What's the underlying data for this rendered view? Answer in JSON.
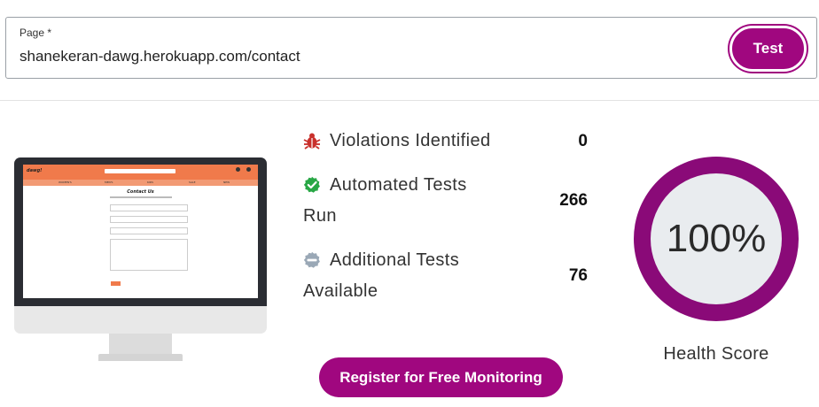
{
  "form": {
    "label": "Page *",
    "url_value": "shanekeran-dawg.herokuapp.com/contact",
    "test_button": "Test"
  },
  "preview": {
    "site_logo": "dawg!",
    "nav_items": [
      "WOMEN'S",
      "MEN'S",
      "KIDS",
      "SALE",
      "NEW"
    ],
    "page_heading": "Contact Us"
  },
  "stats": {
    "violations": {
      "label": "Violations Identified",
      "value": "0",
      "icon": "bug-icon"
    },
    "automated": {
      "label_line1": "Automated Tests",
      "label_line2": "Run",
      "value": "266",
      "icon": "check-circle-icon"
    },
    "additional": {
      "label_line1": "Additional Tests",
      "label_line2": "Available",
      "value": "76",
      "icon": "minus-circle-icon"
    }
  },
  "health": {
    "score": "100%",
    "label": "Health Score"
  },
  "register_button": "Register for Free Monitoring",
  "colors": {
    "accent": "#a0077f",
    "ring": "#8a0a78",
    "violation_icon": "#c9302c",
    "success_icon": "#28a745",
    "neutral_icon": "#9aa8b6"
  }
}
